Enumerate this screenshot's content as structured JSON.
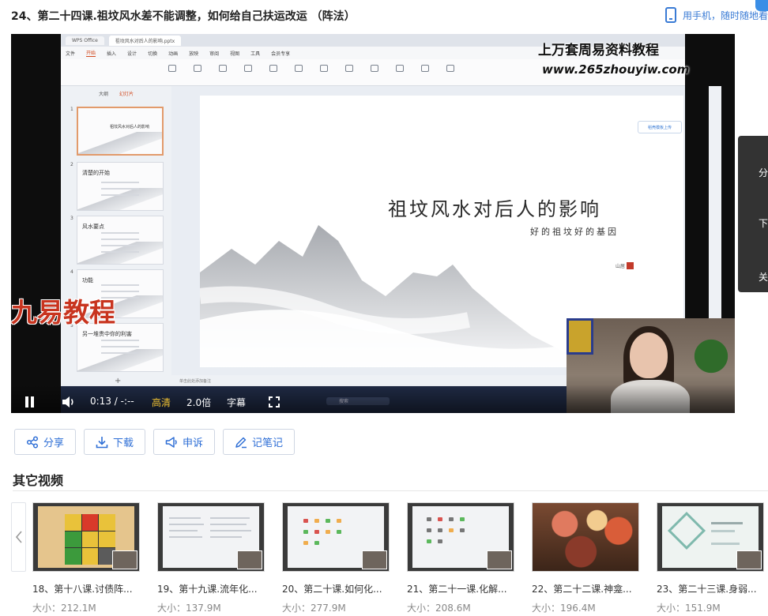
{
  "page": {
    "title": "24、第二十四课.祖坟风水差不能调整，如何给自己扶运改运 （阵法）",
    "mobile_link": "用手机，随时随地看"
  },
  "video": {
    "app": {
      "tabs": [
        "WPS Office",
        "祖坟风水对后人的影响.pptx"
      ],
      "menu": [
        "文件",
        "开始",
        "插入",
        "设计",
        "切换",
        "动画",
        "放映",
        "审阅",
        "视图",
        "工具",
        "会员专享"
      ],
      "active_menu": "开始",
      "panel_tabs": [
        "大纲",
        "幻灯片"
      ],
      "active_panel_tab": "幻灯片",
      "cloud_button": "稻壳模板上传",
      "add_slide": "+",
      "status_note": "单击此处添加备注",
      "search": "搜索"
    },
    "thumbnails": [
      {
        "num": "1",
        "title": "祖坟风水对后人的影响"
      },
      {
        "num": "2",
        "title": "清楚的开始"
      },
      {
        "num": "3",
        "title": "风水要点"
      },
      {
        "num": "4",
        "title": "功能"
      },
      {
        "num": "5",
        "title": "另一堆贵中你的利害"
      }
    ],
    "slide": {
      "title": "祖坟风水对后人的影响",
      "subtitle": "好的祖坟好的基因",
      "author": "山居"
    },
    "watermarks": {
      "line1": "上万套周易资料教程",
      "line2": "www.265zhouyiw.com",
      "brand": "九易教程"
    },
    "side_actions": [
      "分",
      "下",
      "关"
    ],
    "controls": {
      "time": "0:13 / -:--",
      "quality": "高清",
      "speed": "2.0倍",
      "subtitles": "字幕"
    }
  },
  "actions": [
    {
      "label": "分享",
      "icon": "share-icon"
    },
    {
      "label": "下载",
      "icon": "download-icon"
    },
    {
      "label": "申诉",
      "icon": "megaphone-icon"
    },
    {
      "label": "记笔记",
      "icon": "pencil-icon"
    }
  ],
  "other_videos": {
    "heading": "其它视频",
    "items": [
      {
        "title": "18、第十八课.讨债阵...",
        "size": "大小：212.1M"
      },
      {
        "title": "19、第十九课.流年化...",
        "size": "大小：137.9M"
      },
      {
        "title": "20、第二十课.如何化...",
        "size": "大小：277.9M"
      },
      {
        "title": "21、第二十一课.化解...",
        "size": "大小：208.6M"
      },
      {
        "title": "22、第二十二课.神龛...",
        "size": "大小：196.4M"
      },
      {
        "title": "23、第二十三课.身弱...",
        "size": "大小：151.9M"
      }
    ]
  },
  "colors": {
    "accent": "#2f6fd6",
    "quality_highlight": "#f1c232",
    "brand_red": "#c8341f"
  }
}
